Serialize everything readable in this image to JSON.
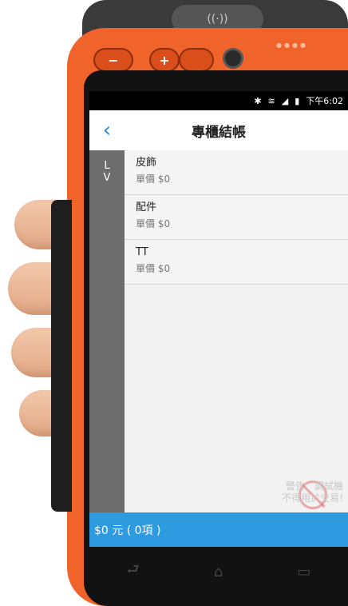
{
  "status_bar": {
    "icons": [
      "bluetooth-icon",
      "wifi-icon",
      "signal-icon",
      "battery-icon"
    ],
    "time": "下午6:02"
  },
  "header": {
    "back_icon": "chevron-left-icon",
    "title": "專櫃結帳"
  },
  "brand": {
    "label_line1": "L",
    "label_line2": "V"
  },
  "items": [
    {
      "name": "皮飾",
      "price": "單價 $0"
    },
    {
      "name": "配件",
      "price": "單價 $0"
    },
    {
      "name": "TT",
      "price": "單價 $0"
    }
  ],
  "watermark": {
    "line1": "警告：調試機",
    "line2": "不得用於交易!"
  },
  "footer": {
    "total": "$0 元 ( 0項 )"
  },
  "hardware": {
    "minus_label": "−",
    "plus_label": "+"
  },
  "colors": {
    "device": "#f0642c",
    "accent": "#2e9be0",
    "brand_col": "#6d6d6d",
    "back": "#2a8ad6"
  }
}
